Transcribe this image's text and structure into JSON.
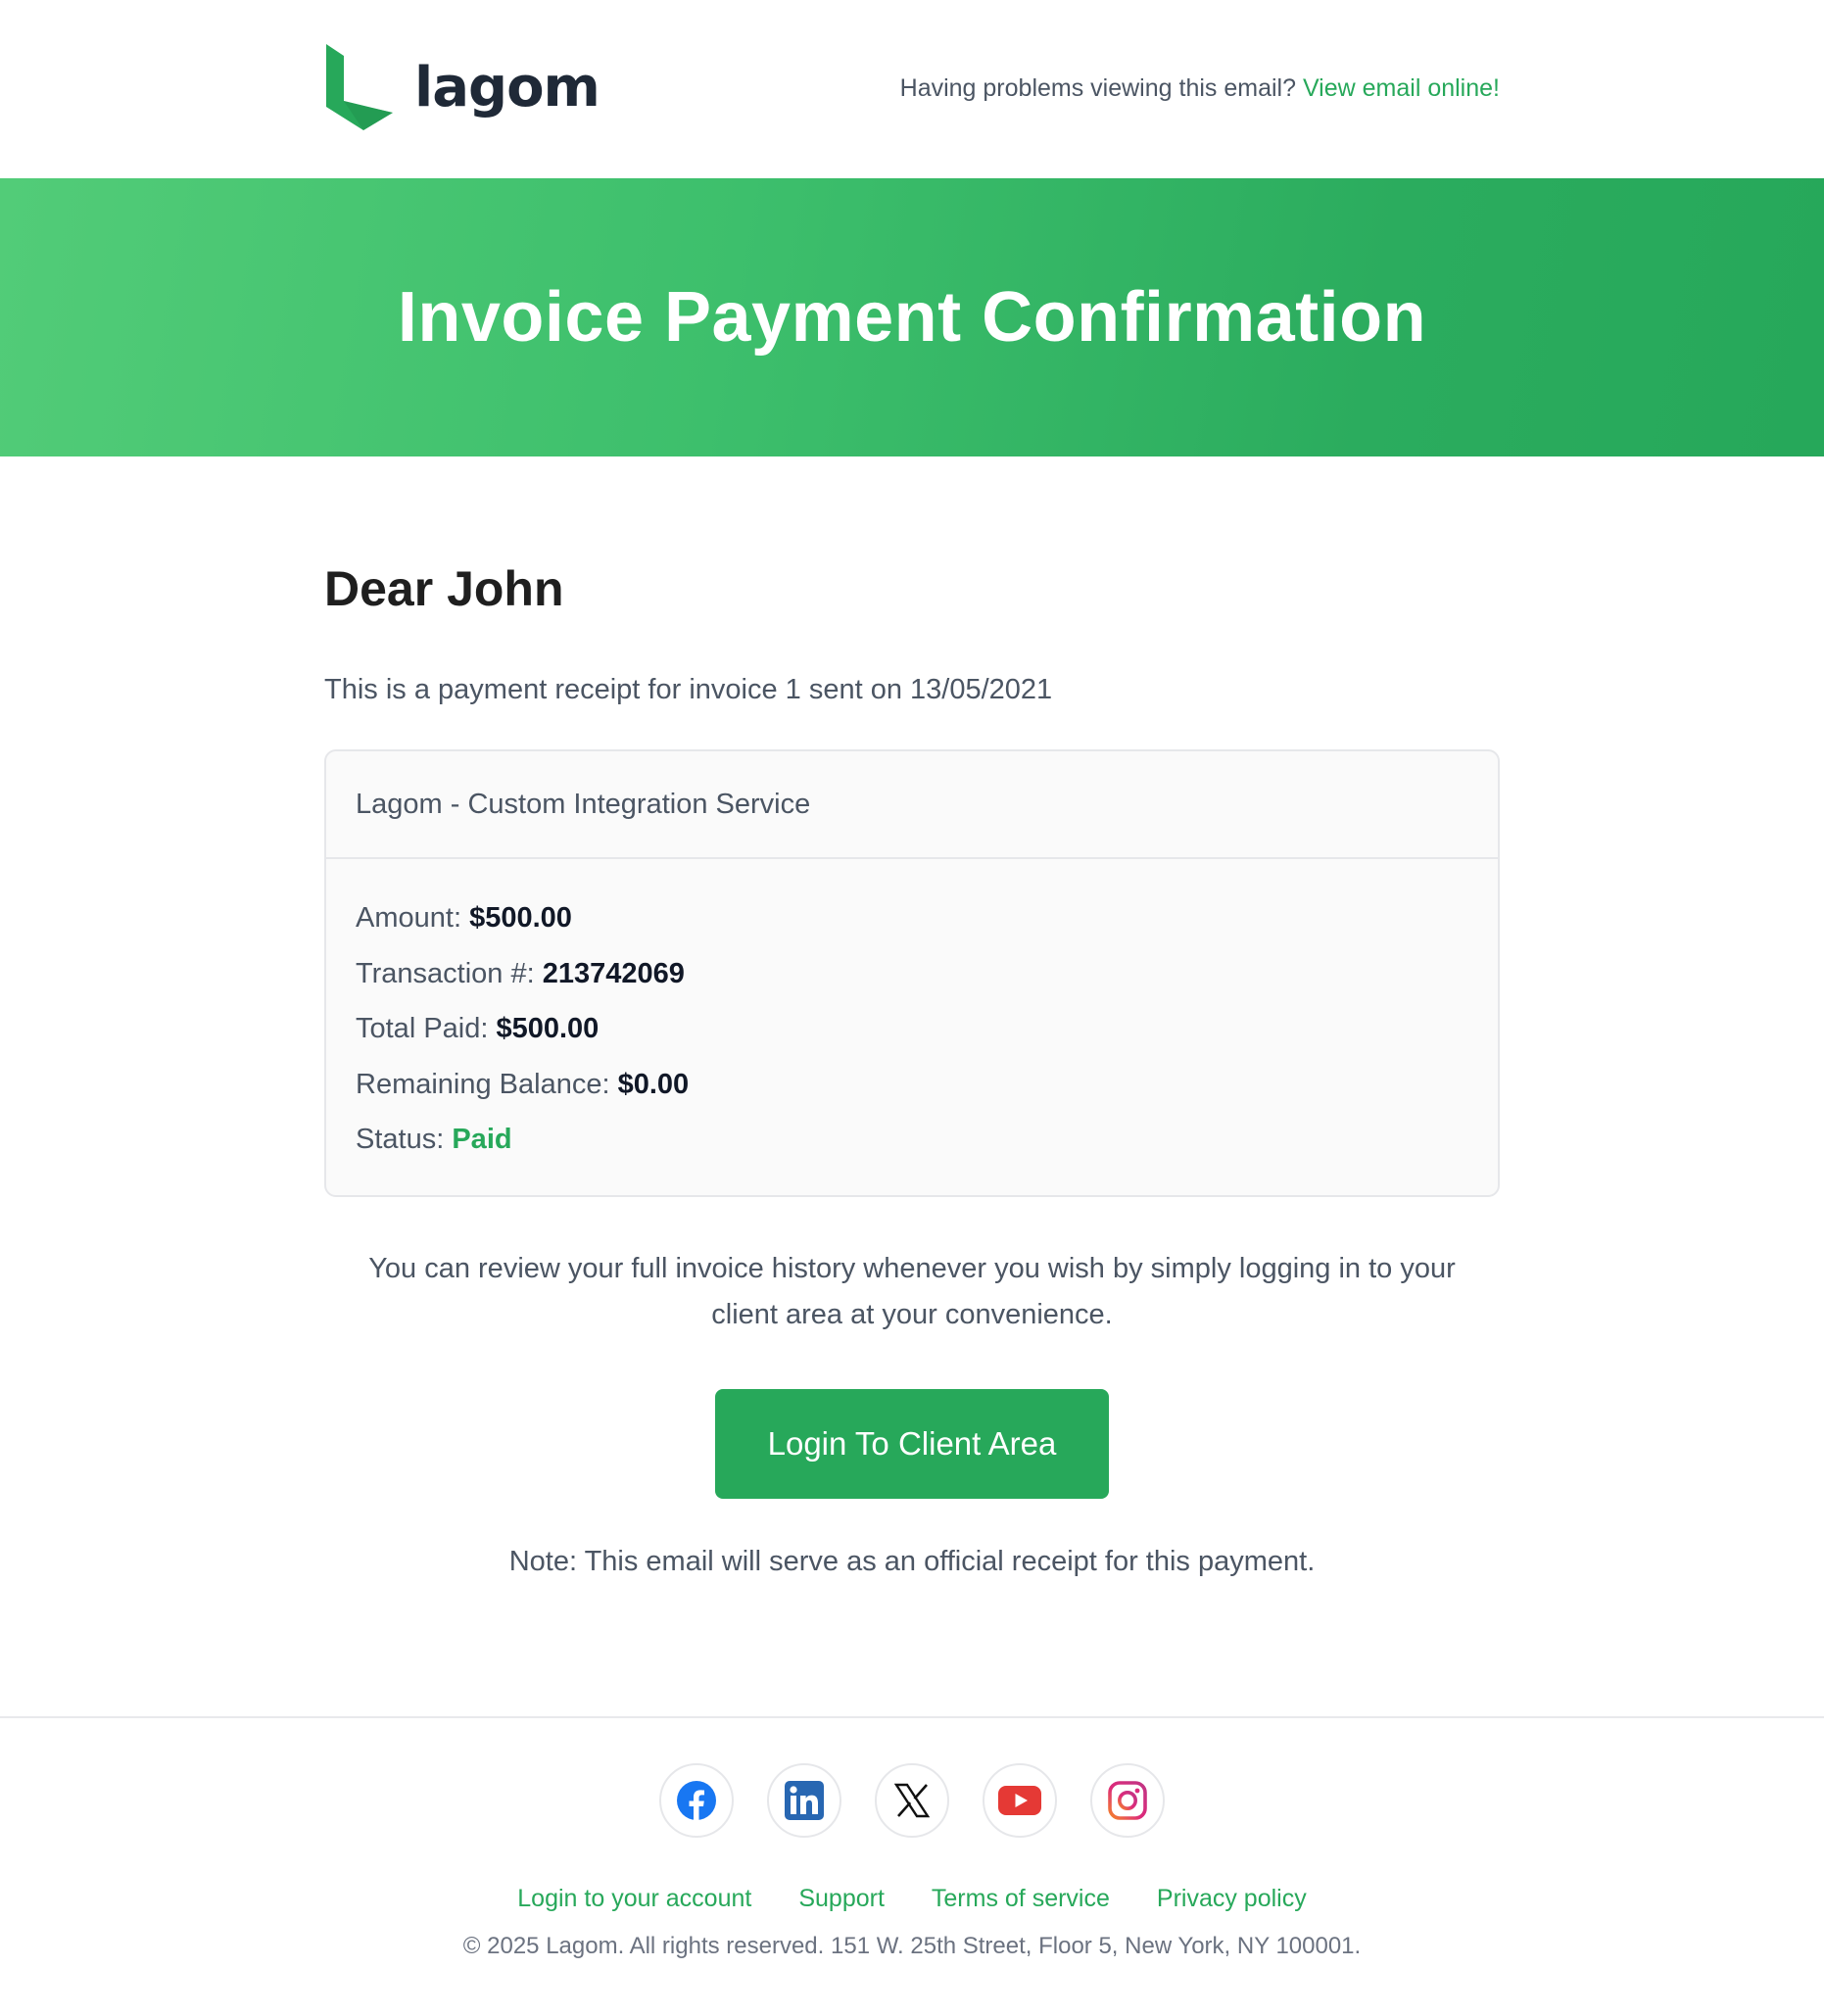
{
  "brand": {
    "name": "lagom",
    "accent_color": "#27a85a",
    "logo_icon": "lagom-logo-icon"
  },
  "header": {
    "problem_text": "Having problems viewing this email?",
    "view_online_label": "View email online!"
  },
  "banner": {
    "title": "Invoice Payment Confirmation"
  },
  "main": {
    "greeting": "Dear John",
    "intro": "This is a payment receipt for invoice 1 sent on 13/05/2021",
    "card": {
      "title": "Lagom - Custom Integration Service",
      "rows": [
        {
          "label": "Amount:",
          "value": "$500.00"
        },
        {
          "label": "Transaction #:",
          "value": "213742069"
        },
        {
          "label": "Total Paid:",
          "value": "$500.00"
        },
        {
          "label": "Remaining Balance:",
          "value": "$0.00"
        },
        {
          "label": "Status:",
          "value": "Paid"
        }
      ]
    },
    "review_text": "You can review your full invoice history whenever you wish by simply logging in to your client area at your convenience.",
    "login_button": "Login To Client Area",
    "note": "Note: This email will serve as an official receipt for this payment."
  },
  "footer": {
    "socials": [
      {
        "icon": "facebook-icon",
        "color": "#1877f2"
      },
      {
        "icon": "linkedin-icon",
        "color": "#2867b2"
      },
      {
        "icon": "x-twitter-icon",
        "color": "#111111"
      },
      {
        "icon": "youtube-icon",
        "color": "#e53935"
      },
      {
        "icon": "instagram-icon",
        "color": "#e1306c"
      }
    ],
    "links": [
      "Login to your account",
      "Support",
      "Terms of service",
      "Privacy policy"
    ],
    "copyright": "© 2025 Lagom. All rights reserved. 151 W. 25th Street, Floor 5, New York, NY 100001."
  }
}
